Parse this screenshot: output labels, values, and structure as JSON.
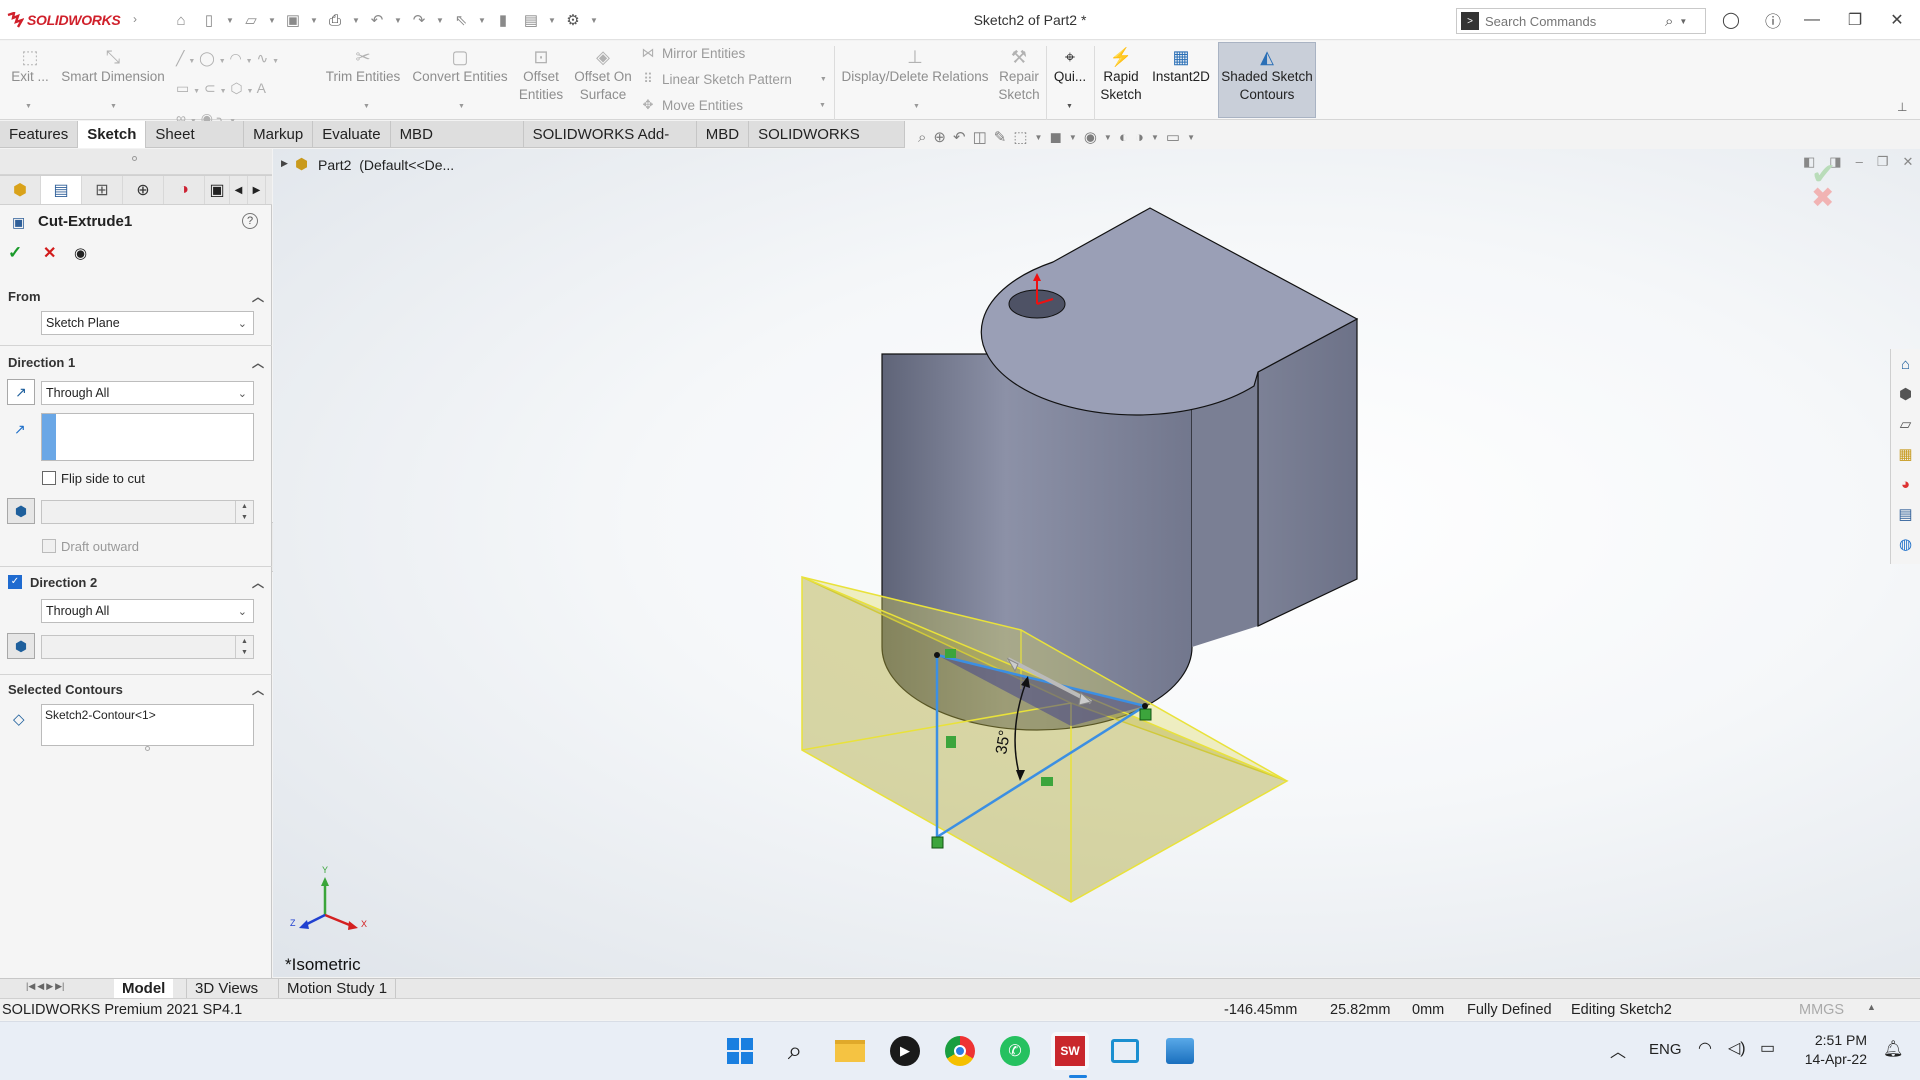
{
  "app": {
    "logo_text": "SOLIDWORKS",
    "title": "Sketch2 of Part2 *",
    "search_placeholder": "Search Commands"
  },
  "ribbon": {
    "exit": "Exit ...",
    "smart_dimension": "Smart Dimension",
    "trim_entities": "Trim Entities",
    "convert_entities": "Convert Entities",
    "offset_entities_1": "Offset",
    "offset_entities_2": "Entities",
    "offset_on_surface_1": "Offset On",
    "offset_on_surface_2": "Surface",
    "mirror_entities": "Mirror Entities",
    "linear_sketch_pattern": "Linear Sketch Pattern",
    "move_entities": "Move Entities",
    "display_delete_relations": "Display/Delete Relations",
    "repair_sketch_1": "Repair",
    "repair_sketch_2": "Sketch",
    "quick_snaps": "Qui...",
    "rapid_sketch_1": "Rapid",
    "rapid_sketch_2": "Sketch",
    "instant2d": "Instant2D",
    "shaded_contours_1": "Shaded Sketch",
    "shaded_contours_2": "Contours"
  },
  "tabs": [
    "Features",
    "Sketch",
    "Sheet Metal",
    "Markup",
    "Evaluate",
    "MBD Dimensions",
    "SOLIDWORKS Add-Ins",
    "MBD",
    "SOLIDWORKS CAM"
  ],
  "active_tab": "Sketch",
  "property_manager": {
    "title": "Cut-Extrude1",
    "from_label": "From",
    "from_value": "Sketch Plane",
    "direction1_label": "Direction 1",
    "direction1_value": "Through All",
    "flip_side": "Flip side to cut",
    "draft_outward": "Draft outward",
    "direction2_label": "Direction 2",
    "direction2_value": "Through All",
    "selected_contours_label": "Selected Contours",
    "selected_contour_item": "Sketch2-Contour<1>"
  },
  "tree": {
    "part_name": "Part2",
    "config": "(Default<<De..."
  },
  "viewport": {
    "view_label": "*Isometric",
    "dimension_text": "35°",
    "triad_x": "X",
    "triad_y": "Y",
    "triad_z": "Z"
  },
  "bottom_tabs": [
    "Model",
    "3D Views",
    "Motion Study 1"
  ],
  "status": {
    "product": "SOLIDWORKS Premium 2021 SP4.1",
    "x": "-146.45mm",
    "y": "25.82mm",
    "z": "0mm",
    "state": "Fully Defined",
    "mode": "Editing Sketch2",
    "units": "MMGS"
  },
  "taskbar": {
    "lang": "ENG",
    "time": "2:51 PM",
    "date": "14-Apr-22"
  },
  "colors": {
    "accent": "#d0202b",
    "preview": "#e3e06a",
    "sketch_line": "#3b8fe3",
    "body": "#8a8fa6"
  }
}
